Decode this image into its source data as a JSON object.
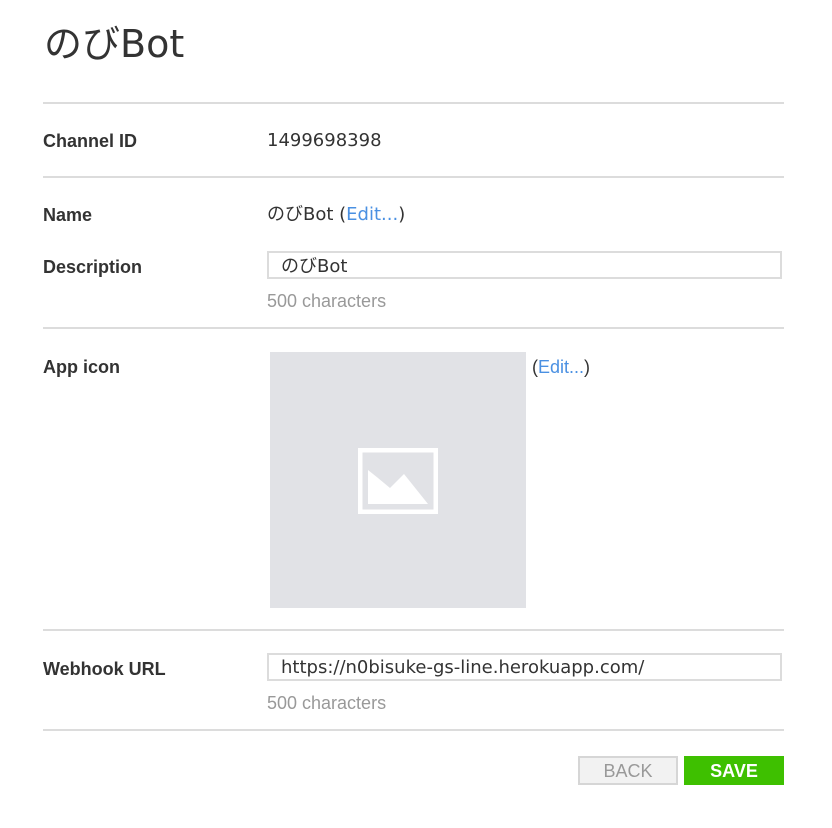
{
  "page": {
    "title": "のびBot"
  },
  "channel_id": {
    "label": "Channel ID",
    "value": "1499698398"
  },
  "name": {
    "label": "Name",
    "value": "のびBot",
    "open_paren": " (",
    "edit_link": "Edit...",
    "close_paren": ")"
  },
  "description": {
    "label": "Description",
    "value": "のびBot",
    "hint": "500 characters"
  },
  "app_icon": {
    "label": "App icon",
    "open_paren": "(",
    "edit_link": "Edit...",
    "close_paren": ")",
    "placeholder_icon": "image-placeholder-icon"
  },
  "webhook": {
    "label": "Webhook URL",
    "value": "https://n0bisuke-gs-line.herokuapp.com/",
    "hint": "500 characters"
  },
  "buttons": {
    "back_label": "BACK",
    "save_label": "SAVE"
  },
  "colors": {
    "link": "#4a90e2",
    "save_button": "#3ec000",
    "divider": "#dcdcdc",
    "icon_placeholder_bg": "#e1e2e6"
  }
}
